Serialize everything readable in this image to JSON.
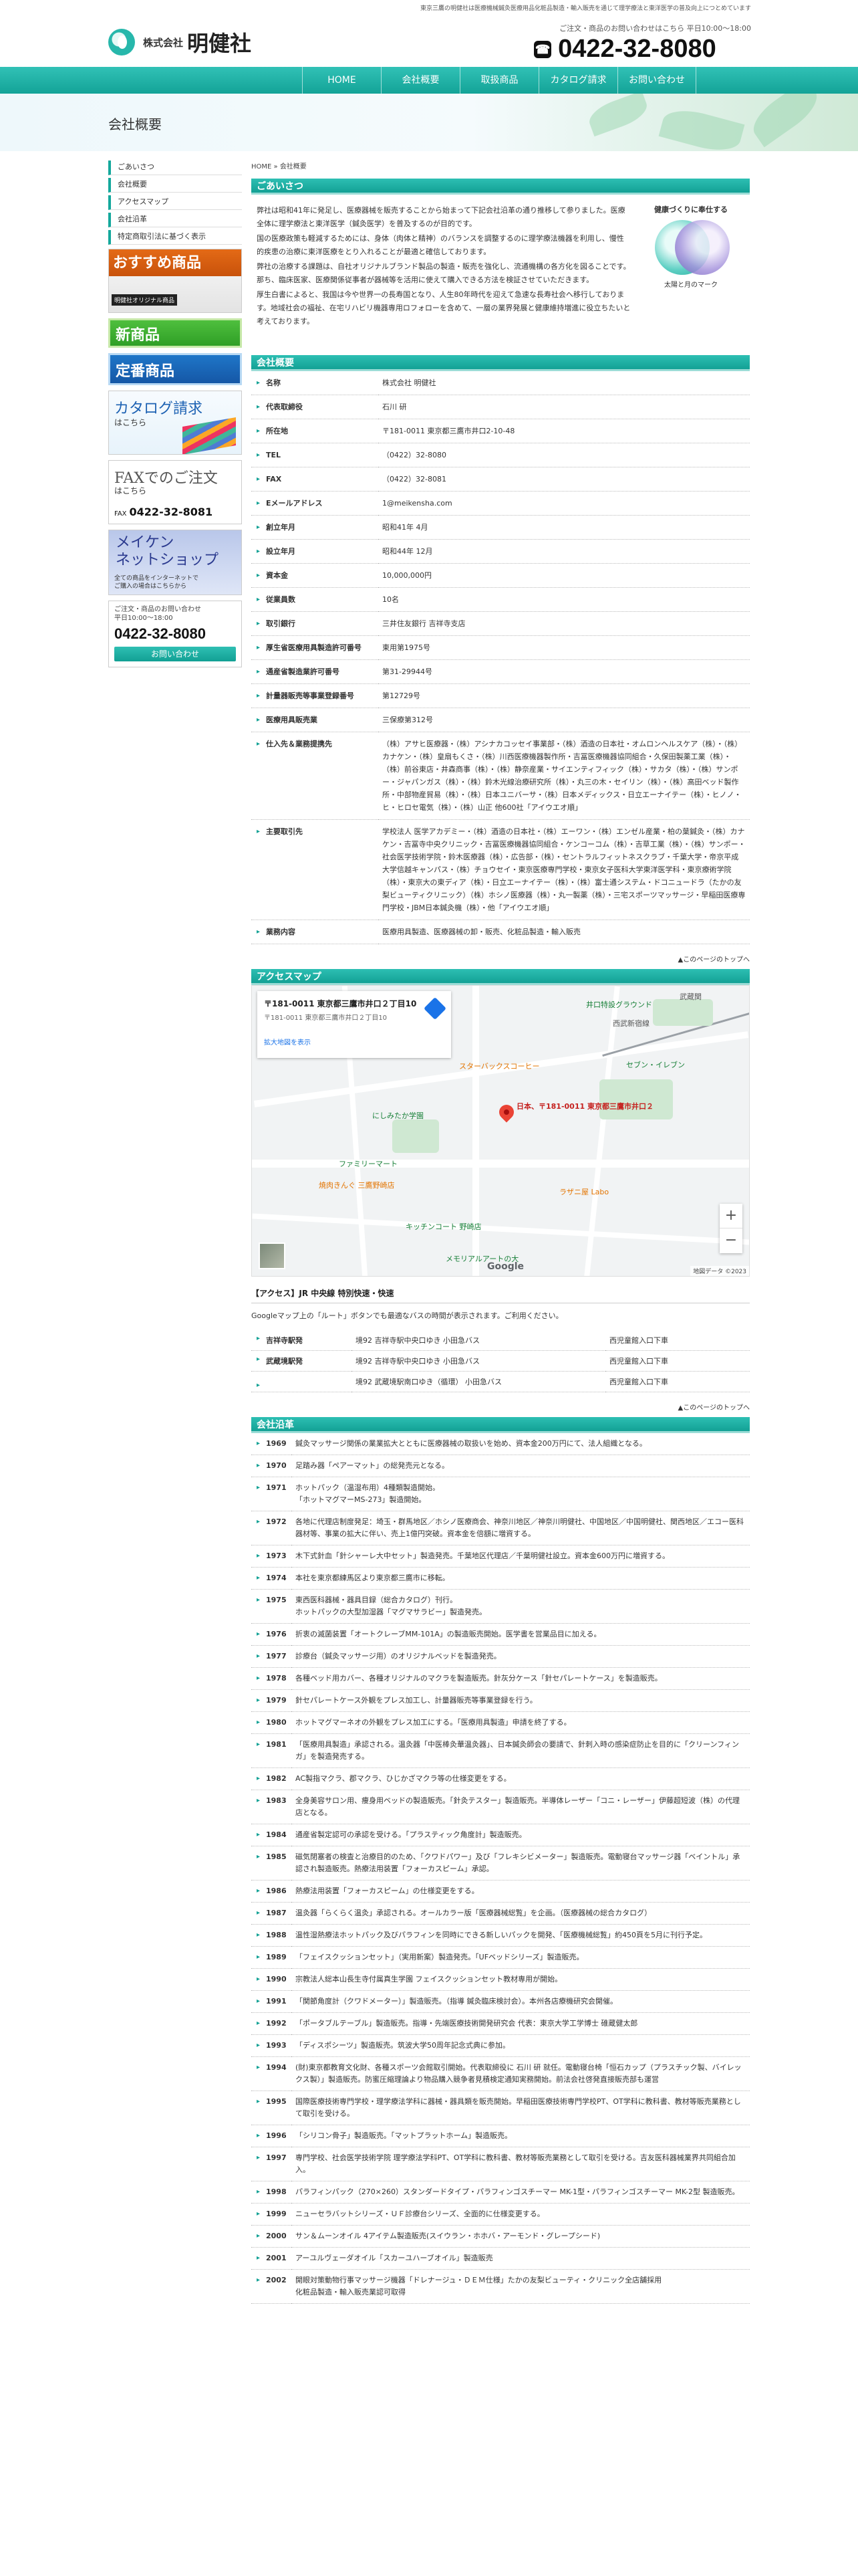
{
  "topbar": {
    "tagline": "東京三鷹の明健社は医療機械鍼灸医療用品化粧品製造・輸入販売を通じて理学療法と東洋医学の普及向上につとめています"
  },
  "header": {
    "logo_corp": "株式会社",
    "logo_name": "明健社",
    "contact_hours": "ご注文・商品のお問い合わせはこちら 平日10:00〜18:00",
    "phone": "0422-32-8080"
  },
  "nav": [
    "HOME",
    "会社概要",
    "取扱商品",
    "カタログ請求",
    "お問い合わせ"
  ],
  "banner": {
    "title": "会社概要"
  },
  "sidebar": {
    "menu": [
      "ごあいさつ",
      "会社概要",
      "アクセスマップ",
      "会社沿革",
      "特定商取引法に基づく表示"
    ],
    "recommend_title": "おすすめ商品",
    "recommend_sub": "明健社オリジナル商品",
    "new_title": "新商品",
    "teiban_title": "定番商品",
    "catalog_title": "カタログ請求",
    "catalog_sub": "はこちら",
    "fax_title": "FAXでのご注文",
    "fax_sub": "はこちら",
    "fax_num_label": "FAX",
    "fax_num": "0422-32-8081",
    "shop_title": "メイケン\nネットショップ",
    "shop_sub": "全ての商品をインターネットで\nご購入の場合はこちらから",
    "contact_head": "ご注文・商品のお問い合わせ\n平日10:00〜18:00",
    "contact_phone": "0422-32-8080",
    "contact_button": "お問い合わせ"
  },
  "main": {
    "breadcrumb": "HOME » 会社概要",
    "greeting": {
      "heading": "ごあいさつ",
      "paragraphs": [
        "弊社は昭和41年に発足し、医療器械を販売することから始まって下記会社沿革の通り推移して参りました。医療全体に理学療法と東洋医学（鍼灸医学）を普及するのが目的です。",
        "国の医療政策も軽減するためには、身体（肉体と精神）のバランスを調整するのに理学療法機器を利用し、慢性的疾患の治療に東洋医療をとり入れることが最適と確信しております。",
        "弊社の治療する課題は、自社オリジナルブランド製品の製造・販売を強化し、流通機構の各方化を図ることです。那ち、臨床医家、医療関係従事者が器械等を活用に使えて購入できる方法を検証させていただきます。",
        "厚生白書によると、我国は今や世界一の長寿国となり、人生80年時代を迎えて急速な長寿社会へ移行しております。地域社会の福祉、在宅リハビリ機器専用ロフォローを含めて、一層の業界発展と健康維持増進に役立ちたいと考えております。"
      ],
      "aside_title": "健康づくりに奉仕する",
      "aside_caption": "太陽と月のマーク"
    },
    "overview": {
      "heading": "会社概要",
      "rows": [
        {
          "label": "名称",
          "value": "株式会社 明健社"
        },
        {
          "label": "代表取締役",
          "value": "石川 研"
        },
        {
          "label": "所在地",
          "value": "〒181-0011 東京都三鷹市井口2-10-48"
        },
        {
          "label": "TEL",
          "value": "（0422）32-8080"
        },
        {
          "label": "FAX",
          "value": "（0422）32-8081"
        },
        {
          "label": "Eメールアドレス",
          "value": "1@meikensha.com"
        },
        {
          "label": "創立年月",
          "value": "昭和41年 4月"
        },
        {
          "label": "設立年月",
          "value": "昭和44年 12月"
        },
        {
          "label": "資本金",
          "value": "10,000,000円"
        },
        {
          "label": "従業員数",
          "value": "10名"
        },
        {
          "label": "取引銀行",
          "value": "三井住友銀行 吉祥寺支店"
        },
        {
          "label": "厚生省医療用具製造許可番号",
          "value": "東用第1975号"
        },
        {
          "label": "通産省製造業許可番号",
          "value": "第31-29944号"
        },
        {
          "label": "計量器販売等事業登録番号",
          "value": "第12729号"
        },
        {
          "label": "医療用具販売業",
          "value": "三保療第312号"
        },
        {
          "label": "仕入先＆業務提携先",
          "value": "（株）アサヒ医療器・（株）アシナカコッセイ事業部・（株）酒造の日本社・オムロンヘルスケア（株）・（株）カナケン・（株）皇扇もくさ・（株）川西医療機器製作所・吉冨医療機器協同組合・久保田製薬工業（株）・（株）前谷東店・井森商事（株）・（株）静奈産業・サイエンティフィック（株）・サカタ（株）・（株）サンポー・ジャパンガス（株）・（株）鈴木光線治療研究所（株）・丸三の木・セイリン（株）・（株）高田ベッド製作所・中部物産貿易（株）・（株）日本ユニバーサ・（株）日本メディックス・日立エーナイテー（株）・ヒノノ・ヒ・ヒロセ電気（株）・（株）山正 他600社「アイウエオ順」"
        },
        {
          "label": "主要取引先",
          "value": "学校法人 医学アカデミー・（株）酒造の日本社・（株）エーワン・（株）エンゼル産業・柏の葉鍼灸・（株）カナケン・吉冨寺中央クリニック・吉冨医療機器協同組合・ケンコーコム（株）・吉草工業（株）・（株）サンポー・社会医学技術学院・鈴木医療器（株）・広告部・（株）・セントラルフィットネスクラブ・千葉大学・帝京平成大学信越キャンパス・（株）チョウセイ・東京医療専門学校・東京女子医科大学東洋医学科・東京療術学院（株）・東京大の東ディア（株）・日立エーナイテー（株）・（株）富士通システム・ドコニュードラ（たかの友梨ビューティクリニック）（株）ホシノ医療器（株）・丸一製薬（株）・三宅スポーツマッサージ・早稲田医療専門学校・JBM日本鍼灸機（株）・他「アイウエオ順」"
        },
        {
          "label": "業務内容",
          "value": "医療用具製造、医療器械の卸・販売、化粧品製造・輸入販売"
        }
      ]
    },
    "pagetop": "▲このページのトップへ",
    "access": {
      "heading": "アクセスマップ",
      "map_card_title": "〒181-0011 東京都三鷹市井口２丁目10",
      "map_card_sub": "〒181-0011 東京都三鷹市井口２丁目10",
      "map_card_link": "拡大地図を表示",
      "map_labels": [
        "西武新宿線",
        "スターバックスコーヒー",
        "セブン・イレブン",
        "日本、〒181-0011 東京都三鷹市井口２",
        "にしみたか学園",
        "ファミリーマート",
        "焼肉きんぐ 三鷹野崎店",
        "ラザニ屋 Labo",
        "キッチンコート 野崎店",
        "メモリアルアートの大",
        "武蔵関",
        "井口特設グラウンド"
      ],
      "map_attrib": "地図データ ©2023",
      "route_title": "【アクセス】JR 中央線 特別快速・快速",
      "note": "Googleマップ上の「ルート」ボタンでも最適なバスの時間が表示されます。ご利用ください。",
      "bus": [
        {
          "station": "吉祥寺駅発",
          "route": "境92 吉祥寺駅中央口ゆき 小田急バス",
          "stop": "西児童館入口下車"
        },
        {
          "station": "武蔵境駅発",
          "route": "境92 吉祥寺駅中央口ゆき 小田急バス",
          "stop": "西児童館入口下車"
        },
        {
          "station": "",
          "route": "境92 武蔵境駅南口ゆき（循環） 小田急バス",
          "stop": "西児童館入口下車"
        }
      ]
    },
    "history": {
      "heading": "会社沿革",
      "rows": [
        {
          "year": "1969",
          "text": "鍼灸マッサージ関係の業業拡大とともに医療器械の取扱いを始め、資本金200万円にて、法人組織となる。"
        },
        {
          "year": "1970",
          "text": "足踏み器「ペアーマット」の総発売元となる。"
        },
        {
          "year": "1971",
          "text": "ホットパック（温湿布用）4種類製造開始。\n「ホットマグマーMS-273」製造開始。"
        },
        {
          "year": "1972",
          "text": "各地に代理店制度発足：埼玉・群馬地区／ホシノ医療商会、神奈川地区／神奈川明健社、中国地区／中国明健社、関西地区／エコー医科器材等、事業の拡大に伴い、売上1億円突破。資本金を倍額に増資する。"
        },
        {
          "year": "1973",
          "text": "木下式針血「針シャーレ大中セット」製造発売。千葉地区代理店／千葉明健社設立。資本金600万円に増資する。"
        },
        {
          "year": "1974",
          "text": "本社を東京都練馬区より東京都三鷹市に移転。"
        },
        {
          "year": "1975",
          "text": "東西医科器械・器具目録（総合カタログ）刊行。\nホットパックの大型加湿器「マグマサラビー」製造発売。"
        },
        {
          "year": "1976",
          "text": "折衷の滅菌装置「オートクレーブMM-101A」の製造販売開始。医学書を営業品目に加える。"
        },
        {
          "year": "1977",
          "text": "診療台（鍼灸マッサージ用）のオリジナルベッドを製造発売。"
        },
        {
          "year": "1978",
          "text": "各種ベッド用カバー、各種オリジナルのマクラを製造販売。針灰分ケース「針セパレートケース」を製造販売。"
        },
        {
          "year": "1979",
          "text": "針セパレートケース外観をプレス加工し、計量器販売等事業登録を行う。"
        },
        {
          "year": "1980",
          "text": "ホットマグマーネオの外観をプレス加工にする。「医療用具製造」申請を終了する。"
        },
        {
          "year": "1981",
          "text": "「医療用具製造」承認される。温灸器「中医棒灸華温灸器」、日本鍼灸師会の要請で、針刺入時の感染症防止を目的に「クリーンフィンガ」を製造発売する。"
        },
        {
          "year": "1982",
          "text": "AC製指マクラ、郡マクラ、ひじかざマクラ等の仕様変更をする。"
        },
        {
          "year": "1983",
          "text": "全身美容サロン用、痩身用ベッドの製造販売。「針灸テスター」製造販売。半導体レーザー「コニ・レーザー」伊藤超短波（株）の代理店となる。"
        },
        {
          "year": "1984",
          "text": "通産省製定認可の承認を受ける。「プラスティック角度計」製造販売。"
        },
        {
          "year": "1985",
          "text": "磁気閉塞者の検査と治療目的のため、「クワドパワー」及び「フレキシビメーター」製造販売。電動寝台マッサージ器「ベイントル」承認され製造販売。熱療法用装置「フォーカスピーム」承認。"
        },
        {
          "year": "1986",
          "text": "熱療法用装置「フォーカスピーム」の仕様変更をする。"
        },
        {
          "year": "1987",
          "text": "温灸器「らくらく温灸」承認される。オールカラー版「医療器械総覧」を企画。（医療器械の総合カタログ）"
        },
        {
          "year": "1988",
          "text": "温性湿熱療法ホットパック及びパラフィンを同時にできる新しいパックを開発、「医療機械総覧」約450頁を5月に刊行予定。"
        },
        {
          "year": "1989",
          "text": "「フェイスクッションセット」（実用新案）製造発売。「UFベッドシリーズ」製造販売。"
        },
        {
          "year": "1990",
          "text": "宗教法人総本山長生寺付属真生学園 フェイスクッションセット教材専用が開始。"
        },
        {
          "year": "1991",
          "text": "「関節角度計（クワドメーター）」製造販売。（指導 鍼灸臨床検討会）。本州各店療機研究会開催。"
        },
        {
          "year": "1992",
          "text": "「ポータブルテーブル」製造販売。指導・先端医療技術開発研究会 代表：東京大学工学博士 碓蔵健太郎"
        },
        {
          "year": "1993",
          "text": "「ディスポシーツ」製造販売。筑波大学50周年記念式典に参加。"
        },
        {
          "year": "1994",
          "text": "(財)東京都教育文化財、各種スポーツ会館取引開始。代表取締役に 石川 研 就任。電動寝台椅「恒石カップ（プラスチック製、バイレックス製）」製造販売。防蜜圧縮理論より物品購入競争者見積検定通知実務開始。前法会社啓発直接販売部も運営"
        },
        {
          "year": "1995",
          "text": "国際医療技術専門学校・理学療法学科に器械・器具類を販売開始。早稲田医療技術専門学校PT、OT学科に教科書、教材等販売業務として取引を受ける。"
        },
        {
          "year": "1996",
          "text": "「シリコン骨子」製造販売。「マットプラットホーム」製造販売。"
        },
        {
          "year": "1997",
          "text": "専門学校、社会医学技術学院 理学療法学科PT、OT学科に教科書、教材等販売業務として取引を受ける。吉友医科器械業界共同組合加入。"
        },
        {
          "year": "1998",
          "text": "パラフィンパック（270×260）スタンダードタイプ・パラフィンゴスチーマー MK-1型・パラフィンゴスチーマー MK-2型 製造販売。"
        },
        {
          "year": "1999",
          "text": "ニューセラバットシリーズ・ＵＦ診療台シリーズ、全面的に仕様変更する。"
        },
        {
          "year": "2000",
          "text": "サン＆ムーンオイル 4アイテム製造販売(スイウラン・ホホバ・アーモンド・グレープシード)"
        },
        {
          "year": "2001",
          "text": "アーユルヴェーダオイル「スカーユハーブオイル」製造販売"
        },
        {
          "year": "2002",
          "text": "開眼対策動物行事マッサージ機器「ドレナージュ・ＤＥＭ仕様」たかの友梨ビューティ・クリニック全店舗採用\n化粧品製造・輸入販売業認可取得"
        }
      ]
    }
  }
}
